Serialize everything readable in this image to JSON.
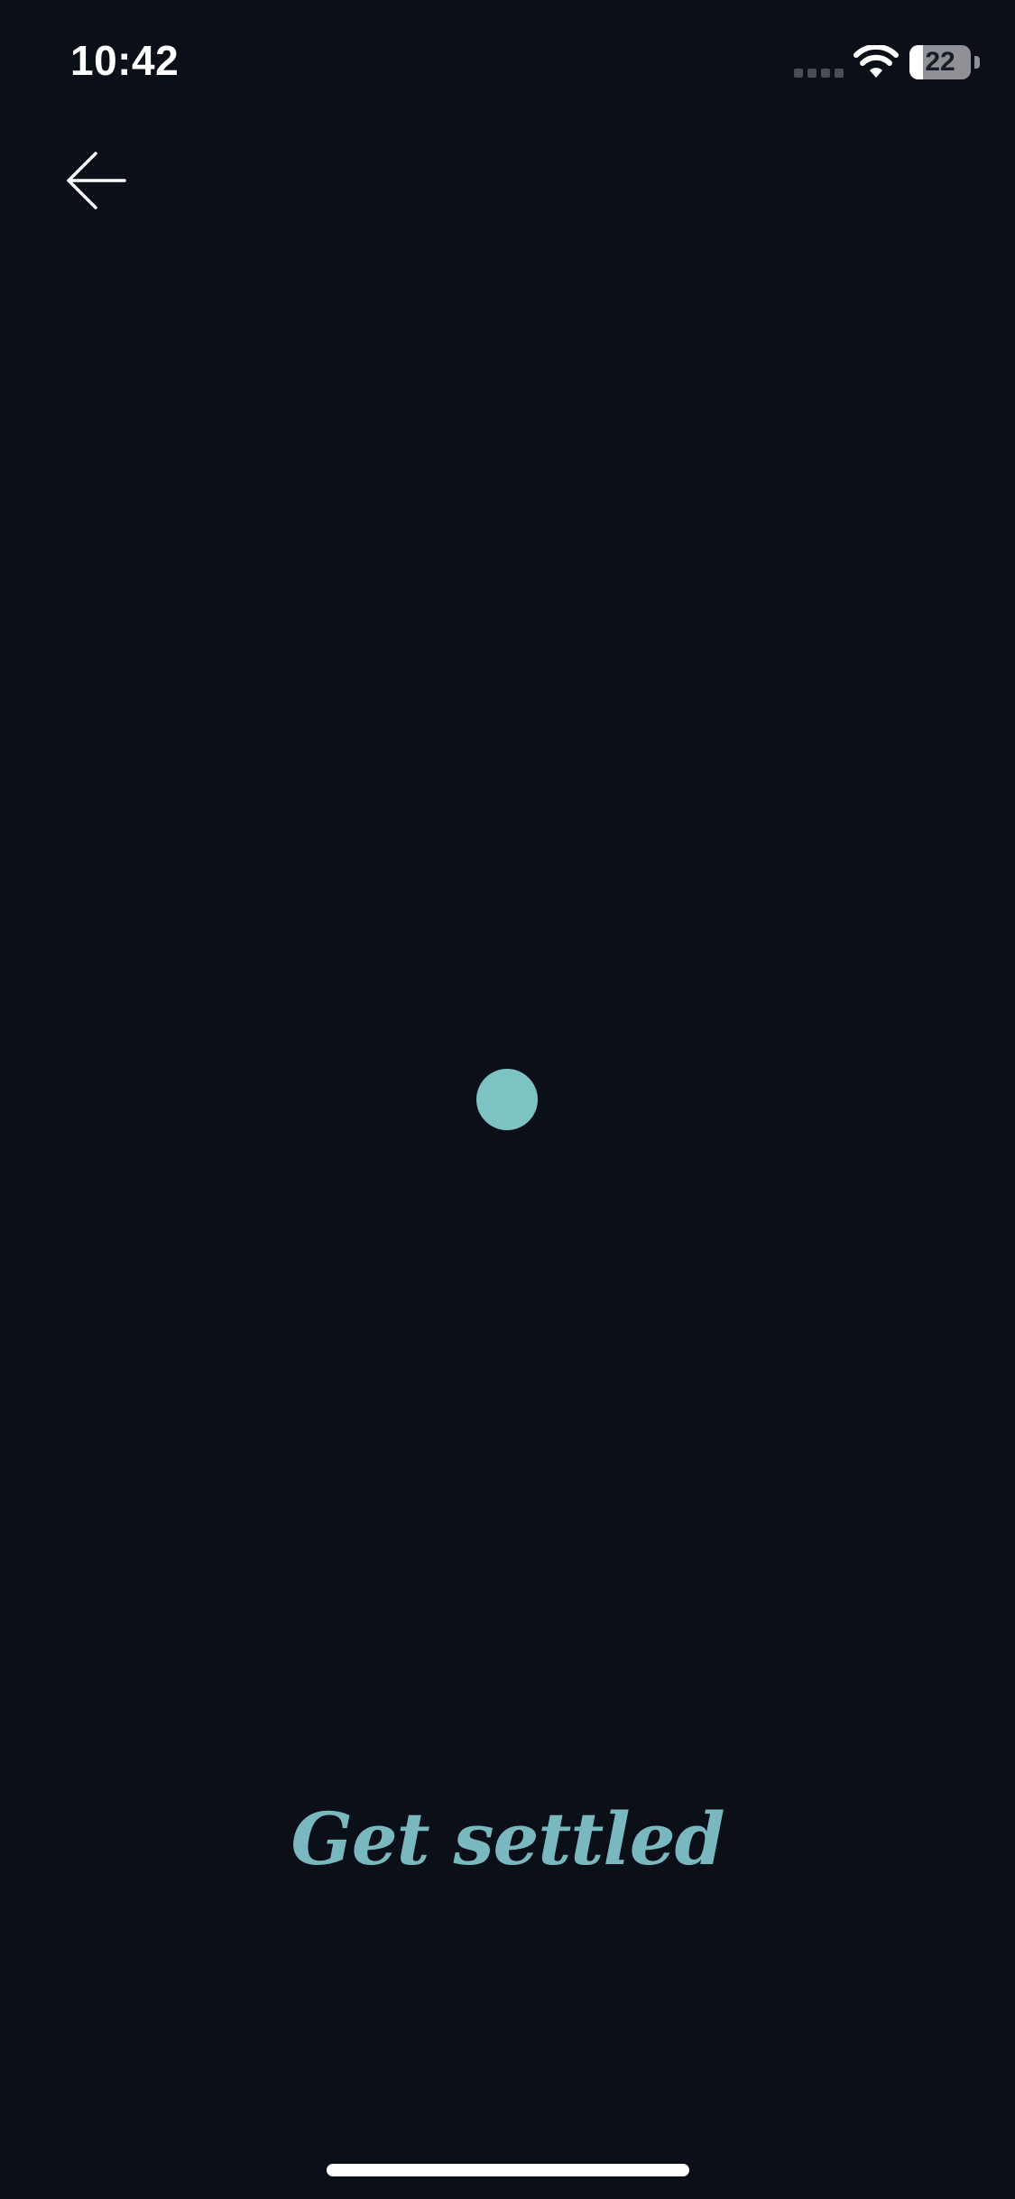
{
  "status_bar": {
    "time": "10:42",
    "battery_level": "22",
    "battery_fraction": 0.22,
    "icons": [
      "cellular-signal-icon",
      "wifi-icon",
      "battery-icon"
    ]
  },
  "nav": {
    "back_icon": "arrow-left-icon"
  },
  "main": {
    "title": "Get settled"
  },
  "colors": {
    "background": "#0b0f18",
    "accent": "#7ec3c3",
    "title": "#7ab8bf",
    "foreground": "#ffffff"
  }
}
